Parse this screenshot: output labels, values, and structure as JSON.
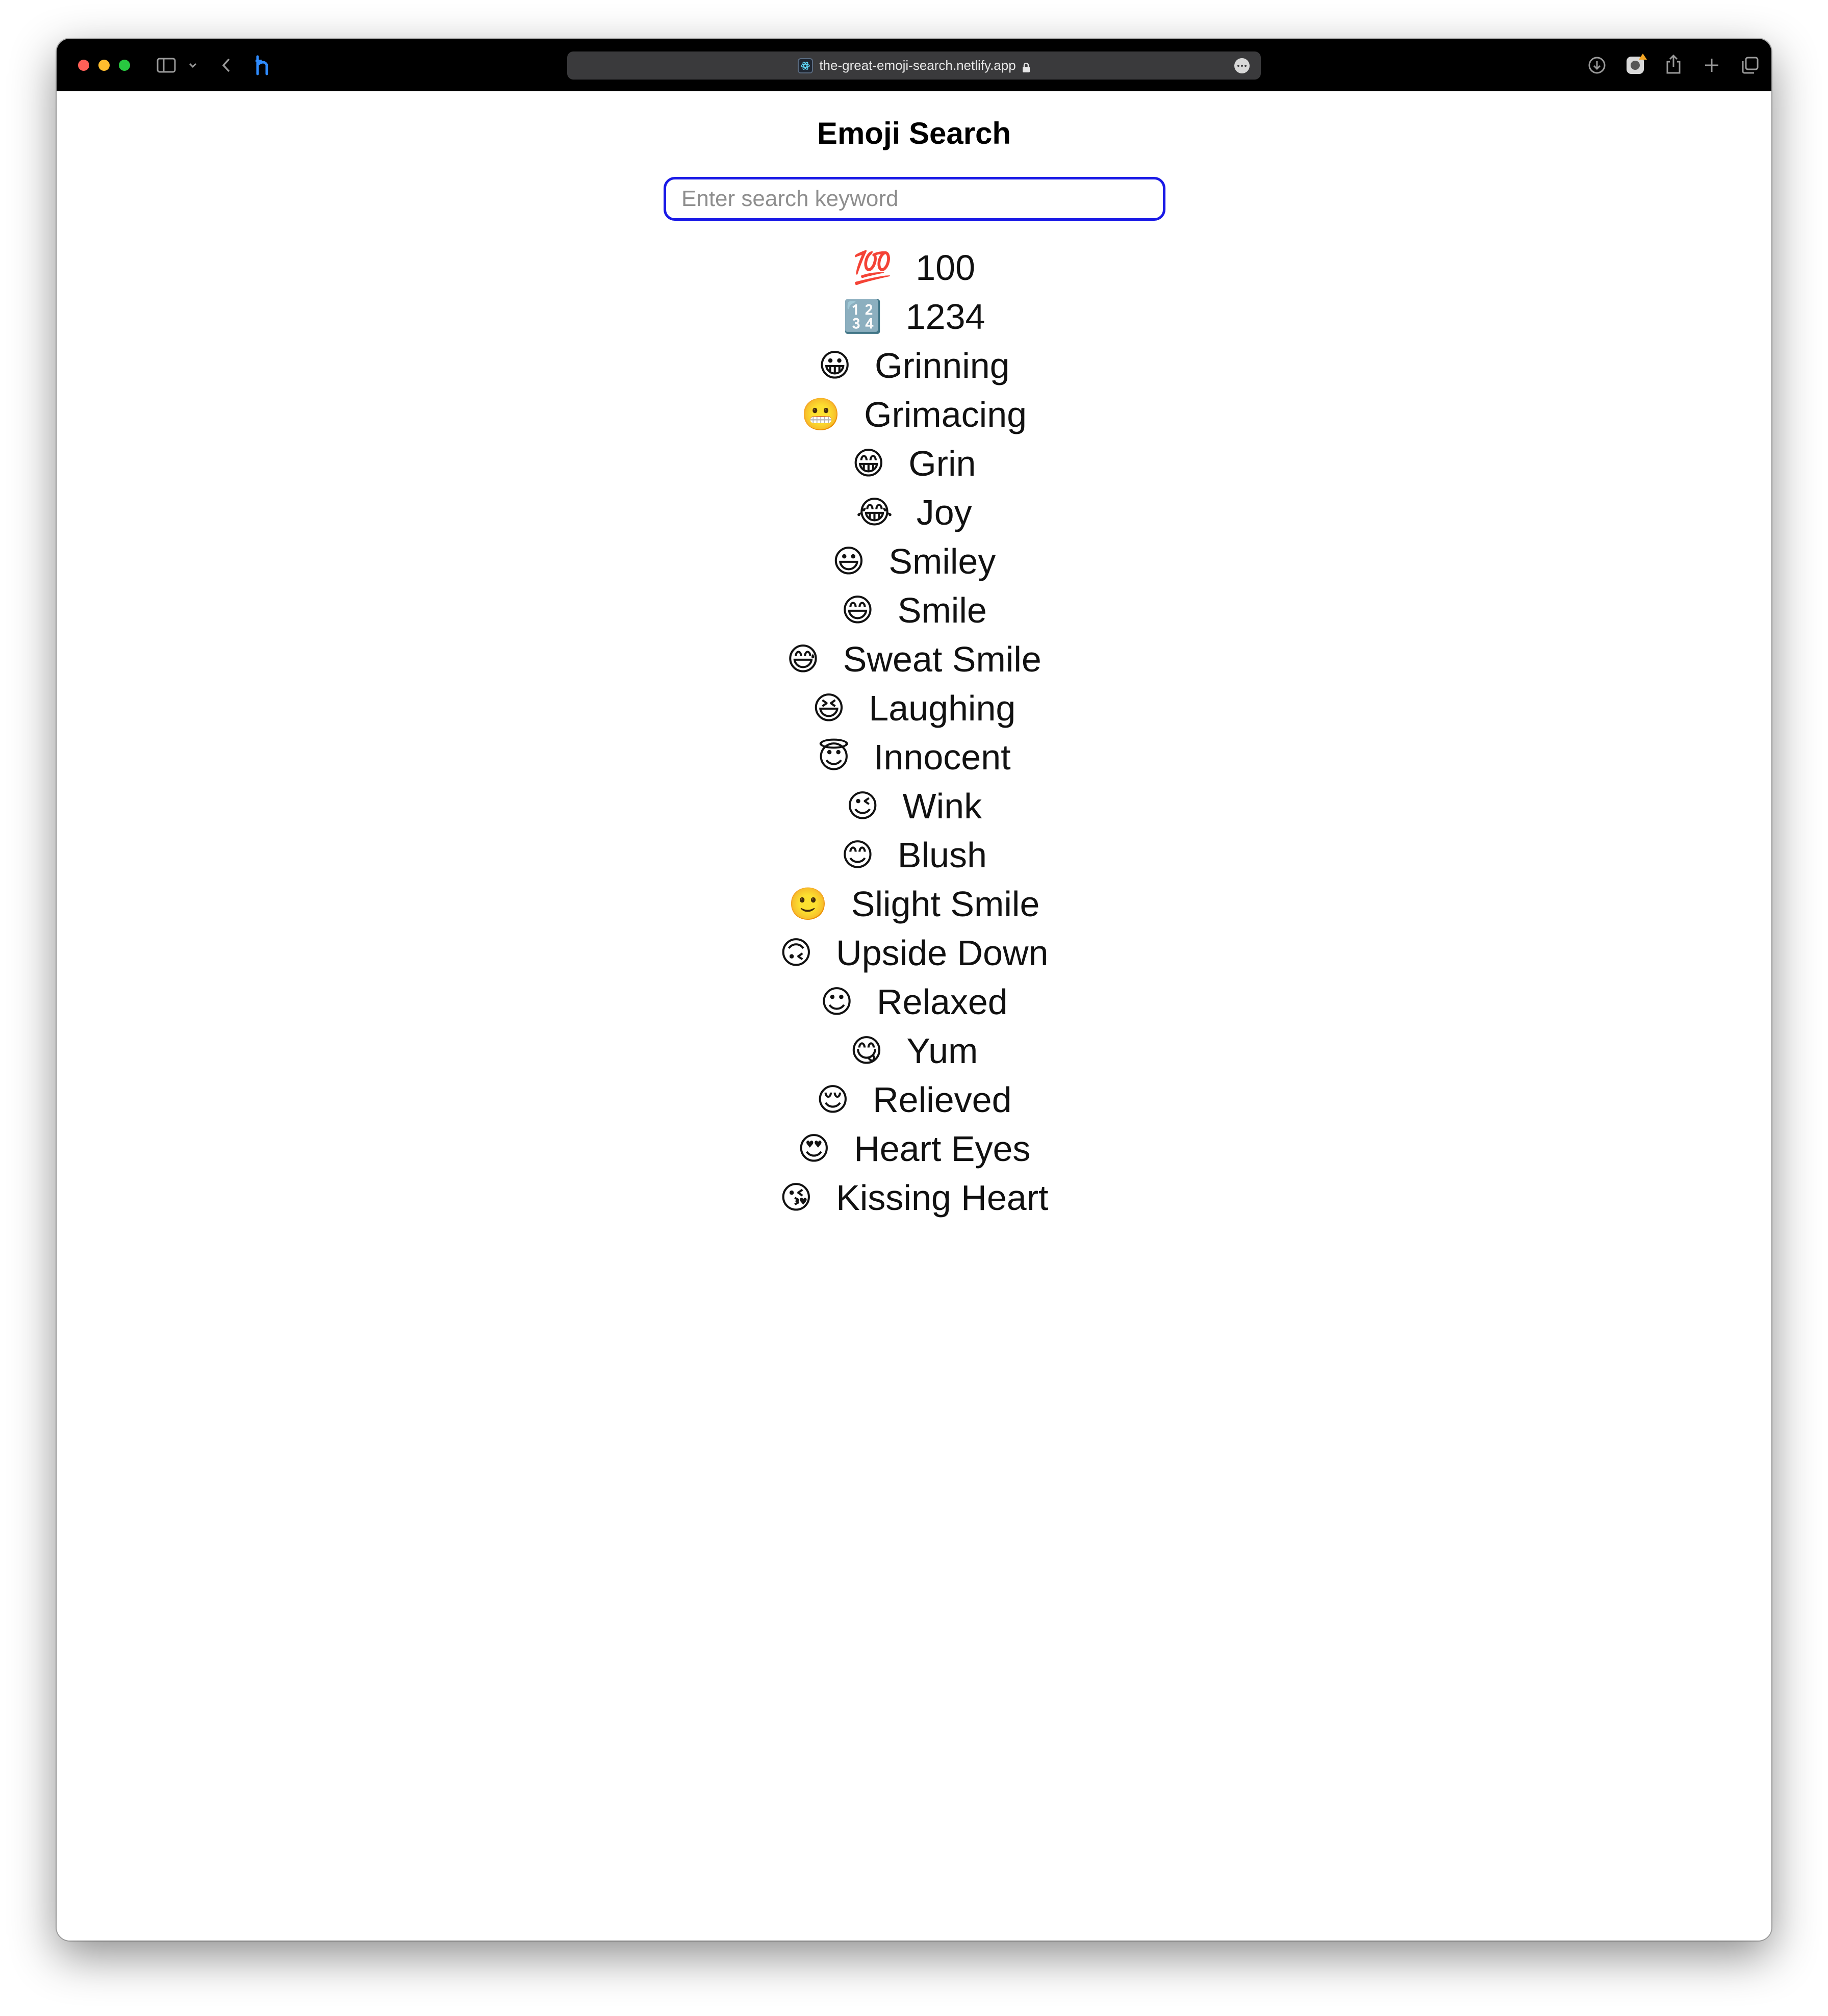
{
  "browser": {
    "url": "the-great-emoji-search.netlify.app",
    "colors": {
      "close": "#ff5f57",
      "minimize": "#febc2e",
      "maximize": "#28c840",
      "toolbar": "#000000",
      "address_bar": "#3a3a3c",
      "search_border": "#1a1ae6"
    },
    "icons": [
      "sidebar-icon",
      "chevron-down-icon",
      "back-icon",
      "extension-icon",
      "site-icon",
      "lock-icon",
      "more-icon",
      "download-icon",
      "camera-extension-icon",
      "share-icon",
      "new-tab-icon",
      "tabs-overview-icon"
    ]
  },
  "page": {
    "title": "Emoji Search",
    "search": {
      "placeholder": "Enter search keyword",
      "value": ""
    },
    "results": [
      {
        "emoji": "💯",
        "name": "100"
      },
      {
        "emoji": "🔢",
        "name": "1234"
      },
      {
        "emoji": "😀",
        "name": "Grinning"
      },
      {
        "emoji": "😬",
        "name": "Grimacing"
      },
      {
        "emoji": "😁",
        "name": "Grin"
      },
      {
        "emoji": "😂",
        "name": "Joy"
      },
      {
        "emoji": "😃",
        "name": "Smiley"
      },
      {
        "emoji": "😄",
        "name": "Smile"
      },
      {
        "emoji": "😅",
        "name": "Sweat Smile"
      },
      {
        "emoji": "😆",
        "name": "Laughing"
      },
      {
        "emoji": "😇",
        "name": "Innocent"
      },
      {
        "emoji": "😉",
        "name": "Wink"
      },
      {
        "emoji": "😊",
        "name": "Blush"
      },
      {
        "emoji": "🙂",
        "name": "Slight Smile"
      },
      {
        "emoji": "🙃",
        "name": "Upside Down"
      },
      {
        "emoji": "☺",
        "name": "Relaxed"
      },
      {
        "emoji": "😋",
        "name": "Yum"
      },
      {
        "emoji": "😌",
        "name": "Relieved"
      },
      {
        "emoji": "😍",
        "name": "Heart Eyes"
      },
      {
        "emoji": "😘",
        "name": "Kissing Heart"
      }
    ]
  }
}
